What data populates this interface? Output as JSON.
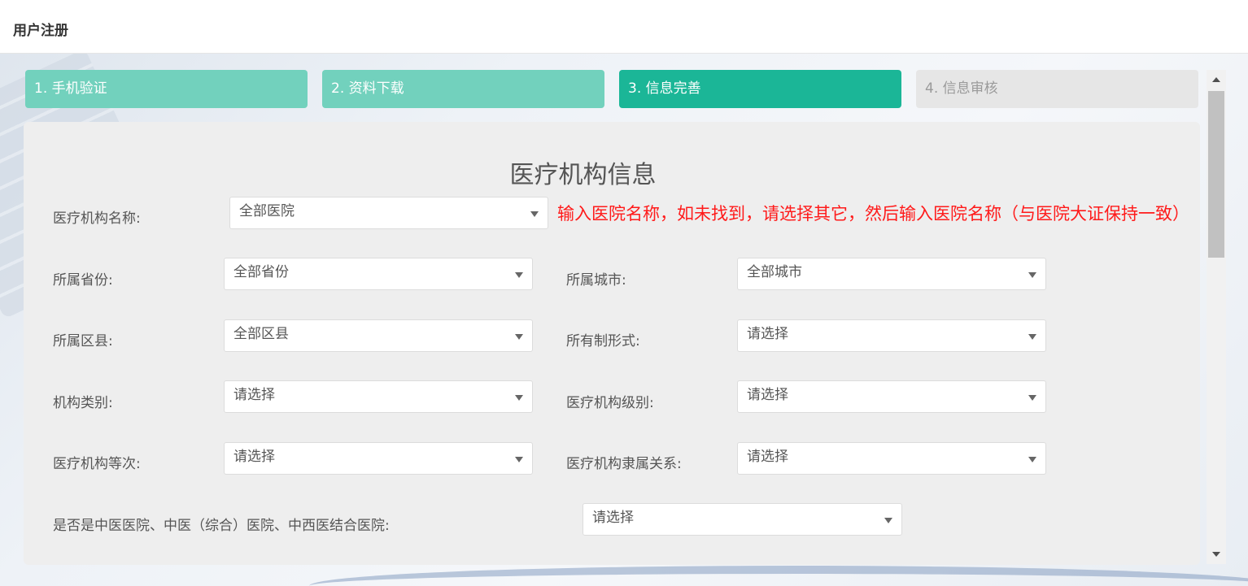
{
  "header": {
    "title": "用户注册"
  },
  "steps": [
    {
      "label": "1. 手机验证",
      "state": "done"
    },
    {
      "label": "2. 资料下载",
      "state": "done"
    },
    {
      "label": "3. 信息完善",
      "state": "active"
    },
    {
      "label": "4. 信息审核",
      "state": "todo"
    }
  ],
  "form": {
    "section_title": "医疗机构信息",
    "hint": "输入医院名称，如未找到，请选择其它，然后输入医院名称（与医院大证保持一致）",
    "fields": {
      "hospital_name": {
        "label": "医疗机构名称:",
        "value": "全部医院"
      },
      "province": {
        "label": "所属省份:",
        "value": "全部省份"
      },
      "city": {
        "label": "所属城市:",
        "value": "全部城市"
      },
      "district": {
        "label": "所属区县:",
        "value": "全部区县"
      },
      "ownership": {
        "label": "所有制形式:",
        "value": "请选择"
      },
      "category": {
        "label": "机构类别:",
        "value": "请选择"
      },
      "level": {
        "label": "医疗机构级别:",
        "value": "请选择"
      },
      "grade": {
        "label": "医疗机构等次:",
        "value": "请选择"
      },
      "affiliation": {
        "label": "医疗机构隶属关系:",
        "value": "请选择"
      },
      "tcm": {
        "label": "是否是中医医院、中医（综合）医院、中西医结合医院:",
        "value": "请选择"
      }
    }
  },
  "colors": {
    "step_done": "#72d1bd",
    "step_active": "#1bb697",
    "step_todo": "#e6e6e6",
    "hint": "#ff1a1a"
  }
}
